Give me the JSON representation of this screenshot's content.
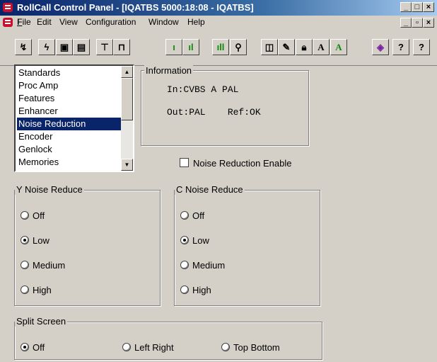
{
  "window": {
    "title": "RollCall Control Panel - [IQATBS 5000:18:08 - IQATBS]"
  },
  "menu": [
    "File",
    "Edit",
    "View",
    "Configuration",
    "Window",
    "Help"
  ],
  "menu_access_keys": [
    "F",
    "E",
    "V",
    "C",
    "W",
    "H"
  ],
  "toolbar_icons": [
    "connect-icon",
    "lightning-icon",
    "save-icon",
    "save-all-icon",
    "network-icon",
    "device-icon",
    "signal-bar-1-icon",
    "signal-bar-2-icon",
    "signal-bar-3-icon",
    "search-key-icon",
    "book-icon",
    "edit-icon",
    "lock-icon",
    "font-a-icon",
    "font-a-green-icon",
    "diary-icon",
    "help-icon",
    "question-icon"
  ],
  "nav_list": {
    "items": [
      "Standards",
      "Proc Amp",
      "Features",
      "Enhancer",
      "Noise Reduction",
      "Encoder",
      "Genlock",
      "Memories"
    ],
    "selected": "Noise Reduction"
  },
  "information": {
    "label": "Information",
    "input_line": "In:CVBS A PAL",
    "output_line": "Out:PAL    Ref:OK"
  },
  "noise_reduction_enable": {
    "label": "Noise Reduction Enable",
    "checked": false
  },
  "y_noise": {
    "label": "Y Noise Reduce",
    "options": [
      "Off",
      "Low",
      "Medium",
      "High"
    ],
    "selected": "Low"
  },
  "c_noise": {
    "label": "C Noise Reduce",
    "options": [
      "Off",
      "Low",
      "Medium",
      "High"
    ],
    "selected": "Low"
  },
  "split_screen": {
    "label": "Split Screen",
    "options": [
      "Off",
      "Left Right",
      "Top Bottom"
    ],
    "selected": "Off"
  },
  "colors": {
    "title_bar": "#0a246a",
    "selection": "#0a246a",
    "face": "#d4d0c8",
    "accent_red": "#c8102e"
  }
}
